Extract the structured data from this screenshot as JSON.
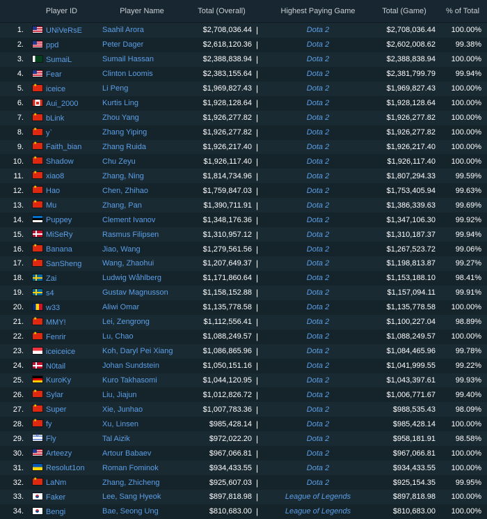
{
  "headers": {
    "player_id": "Player ID",
    "player_name": "Player Name",
    "total_overall": "Total (Overall)",
    "highest_game": "Highest Paying Game",
    "total_game": "Total (Game)",
    "pct_total": "% of Total"
  },
  "separator": "|",
  "rows": [
    {
      "rank": "1.",
      "flag": "us",
      "id": "UNiVeRsE",
      "name": "Saahil Arora",
      "total": "$2,708,036.44",
      "game": "Dota 2",
      "game_total": "$2,708,036.44",
      "pct": "100.00%"
    },
    {
      "rank": "2.",
      "flag": "us",
      "id": "ppd",
      "name": "Peter Dager",
      "total": "$2,618,120.36",
      "game": "Dota 2",
      "game_total": "$2,602,008.62",
      "pct": "99.38%"
    },
    {
      "rank": "3.",
      "flag": "pk",
      "id": "SumaiL",
      "name": "Sumail Hassan",
      "total": "$2,388,838.94",
      "game": "Dota 2",
      "game_total": "$2,388,838.94",
      "pct": "100.00%"
    },
    {
      "rank": "4.",
      "flag": "us",
      "id": "Fear",
      "name": "Clinton Loomis",
      "total": "$2,383,155.64",
      "game": "Dota 2",
      "game_total": "$2,381,799.79",
      "pct": "99.94%"
    },
    {
      "rank": "5.",
      "flag": "cn",
      "id": "iceice",
      "name": "Li Peng",
      "total": "$1,969,827.43",
      "game": "Dota 2",
      "game_total": "$1,969,827.43",
      "pct": "100.00%"
    },
    {
      "rank": "6.",
      "flag": "ca",
      "id": "Aui_2000",
      "name": "Kurtis Ling",
      "total": "$1,928,128.64",
      "game": "Dota 2",
      "game_total": "$1,928,128.64",
      "pct": "100.00%"
    },
    {
      "rank": "7.",
      "flag": "cn",
      "id": "bLink",
      "name": "Zhou Yang",
      "total": "$1,926,277.82",
      "game": "Dota 2",
      "game_total": "$1,926,277.82",
      "pct": "100.00%"
    },
    {
      "rank": "8.",
      "flag": "cn",
      "id": "y`",
      "name": "Zhang Yiping",
      "total": "$1,926,277.82",
      "game": "Dota 2",
      "game_total": "$1,926,277.82",
      "pct": "100.00%"
    },
    {
      "rank": "9.",
      "flag": "cn",
      "id": "Faith_bian",
      "name": "Zhang Ruida",
      "total": "$1,926,217.40",
      "game": "Dota 2",
      "game_total": "$1,926,217.40",
      "pct": "100.00%"
    },
    {
      "rank": "10.",
      "flag": "cn",
      "id": "Shadow",
      "name": "Chu Zeyu",
      "total": "$1,926,117.40",
      "game": "Dota 2",
      "game_total": "$1,926,117.40",
      "pct": "100.00%"
    },
    {
      "rank": "11.",
      "flag": "cn",
      "id": "xiao8",
      "name": "Zhang, Ning",
      "total": "$1,814,734.96",
      "game": "Dota 2",
      "game_total": "$1,807,294.33",
      "pct": "99.59%"
    },
    {
      "rank": "12.",
      "flag": "cn",
      "id": "Hao",
      "name": "Chen, Zhihao",
      "total": "$1,759,847.03",
      "game": "Dota 2",
      "game_total": "$1,753,405.94",
      "pct": "99.63%"
    },
    {
      "rank": "13.",
      "flag": "cn",
      "id": "Mu",
      "name": "Zhang, Pan",
      "total": "$1,390,711.91",
      "game": "Dota 2",
      "game_total": "$1,386,339.63",
      "pct": "99.69%"
    },
    {
      "rank": "14.",
      "flag": "ee",
      "id": "Puppey",
      "name": "Clement Ivanov",
      "total": "$1,348,176.36",
      "game": "Dota 2",
      "game_total": "$1,347,106.30",
      "pct": "99.92%"
    },
    {
      "rank": "15.",
      "flag": "dk",
      "id": "MiSeRy",
      "name": "Rasmus Filipsen",
      "total": "$1,310,957.12",
      "game": "Dota 2",
      "game_total": "$1,310,187.37",
      "pct": "99.94%"
    },
    {
      "rank": "16.",
      "flag": "cn",
      "id": "Banana",
      "name": "Jiao, Wang",
      "total": "$1,279,561.56",
      "game": "Dota 2",
      "game_total": "$1,267,523.72",
      "pct": "99.06%"
    },
    {
      "rank": "17.",
      "flag": "cn",
      "id": "SanSheng",
      "name": "Wang, Zhaohui",
      "total": "$1,207,649.37",
      "game": "Dota 2",
      "game_total": "$1,198,813.87",
      "pct": "99.27%"
    },
    {
      "rank": "18.",
      "flag": "se",
      "id": "Zai",
      "name": "Ludwig Wåhlberg",
      "total": "$1,171,860.64",
      "game": "Dota 2",
      "game_total": "$1,153,188.10",
      "pct": "98.41%"
    },
    {
      "rank": "19.",
      "flag": "se",
      "id": "s4",
      "name": "Gustav Magnusson",
      "total": "$1,158,152.88",
      "game": "Dota 2",
      "game_total": "$1,157,094.11",
      "pct": "99.91%"
    },
    {
      "rank": "20.",
      "flag": "ro",
      "id": "w33",
      "name": "Aliwi Omar",
      "total": "$1,135,778.58",
      "game": "Dota 2",
      "game_total": "$1,135,778.58",
      "pct": "100.00%"
    },
    {
      "rank": "21.",
      "flag": "cn",
      "id": "MMY!",
      "name": "Lei, Zengrong",
      "total": "$1,112,556.41",
      "game": "Dota 2",
      "game_total": "$1,100,227.04",
      "pct": "98.89%"
    },
    {
      "rank": "22.",
      "flag": "cn",
      "id": "Fenrir",
      "name": "Lu, Chao",
      "total": "$1,088,249.57",
      "game": "Dota 2",
      "game_total": "$1,088,249.57",
      "pct": "100.00%"
    },
    {
      "rank": "23.",
      "flag": "sg",
      "id": "iceiceice",
      "name": "Koh, Daryl Pei Xiang",
      "total": "$1,086,865.96",
      "game": "Dota 2",
      "game_total": "$1,084,465.96",
      "pct": "99.78%"
    },
    {
      "rank": "24.",
      "flag": "dk",
      "id": "N0tail",
      "name": "Johan Sundstein",
      "total": "$1,050,151.16",
      "game": "Dota 2",
      "game_total": "$1,041,999.55",
      "pct": "99.22%"
    },
    {
      "rank": "25.",
      "flag": "de",
      "id": "KuroKy",
      "name": "Kuro Takhasomi",
      "total": "$1,044,120.95",
      "game": "Dota 2",
      "game_total": "$1,043,397.61",
      "pct": "99.93%"
    },
    {
      "rank": "26.",
      "flag": "cn",
      "id": "Sylar",
      "name": "Liu, Jiajun",
      "total": "$1,012,826.72",
      "game": "Dota 2",
      "game_total": "$1,006,771.67",
      "pct": "99.40%"
    },
    {
      "rank": "27.",
      "flag": "cn",
      "id": "Super",
      "name": "Xie, Junhao",
      "total": "$1,007,783.36",
      "game": "Dota 2",
      "game_total": "$988,535.43",
      "pct": "98.09%"
    },
    {
      "rank": "28.",
      "flag": "cn",
      "id": "fy",
      "name": "Xu, Linsen",
      "total": "$985,428.14",
      "game": "Dota 2",
      "game_total": "$985,428.14",
      "pct": "100.00%"
    },
    {
      "rank": "29.",
      "flag": "il",
      "id": "Fly",
      "name": "Tal Aizik",
      "total": "$972,022.20",
      "game": "Dota 2",
      "game_total": "$958,181.91",
      "pct": "98.58%"
    },
    {
      "rank": "30.",
      "flag": "us",
      "id": "Arteezy",
      "name": "Artour Babaev",
      "total": "$967,066.81",
      "game": "Dota 2",
      "game_total": "$967,066.81",
      "pct": "100.00%"
    },
    {
      "rank": "31.",
      "flag": "ua",
      "id": "Resolut1on",
      "name": "Roman Fominok",
      "total": "$934,433.55",
      "game": "Dota 2",
      "game_total": "$934,433.55",
      "pct": "100.00%"
    },
    {
      "rank": "32.",
      "flag": "cn",
      "id": "LaNm",
      "name": "Zhang, Zhicheng",
      "total": "$925,607.03",
      "game": "Dota 2",
      "game_total": "$925,154.35",
      "pct": "99.95%"
    },
    {
      "rank": "33.",
      "flag": "kr",
      "id": "Faker",
      "name": "Lee, Sang Hyeok",
      "total": "$897,818.98",
      "game": "League of Legends",
      "game_total": "$897,818.98",
      "pct": "100.00%"
    },
    {
      "rank": "34.",
      "flag": "kr",
      "id": "Bengi",
      "name": "Bae, Seong Ung",
      "total": "$810,683.00",
      "game": "League of Legends",
      "game_total": "$810,683.00",
      "pct": "100.00%"
    }
  ]
}
